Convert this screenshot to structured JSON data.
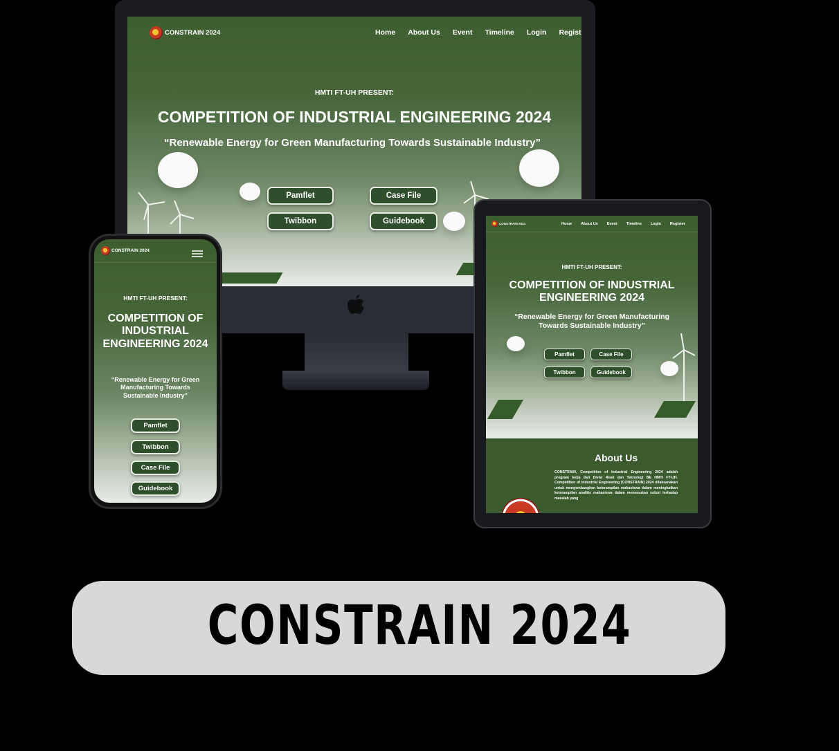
{
  "site": {
    "brand": "CONSTRAIN 2024",
    "nav": [
      "Home",
      "About Us",
      "Event",
      "Timeline",
      "Login",
      "Register"
    ],
    "desktop_nav_visible": [
      "Home",
      "About Us",
      "Event",
      "Timeline",
      "Login",
      "Registe"
    ],
    "presenter": "HMTI FT-UH PRESENT:",
    "title": "COMPETITION OF INDUSTRIAL ENGINEERING 2024",
    "tagline": "“Renewable Energy for Green Manufacturing Towards Sustainable Industry”",
    "buttons": {
      "pamflet": "Pamflet",
      "case_file": "Case File",
      "twibbon": "Twibbon",
      "guidebook": "Guidebook"
    },
    "about": {
      "heading": "About Us",
      "body": "CONSTRAIN, Competition of Industrial Engineering 2024 adalah program kerja dari Divisi Riset dan Teknologi BE HMTI FT-UH. Competition of Industrial Engineering (CONSTRAIN) 2024 dilaksanakan untuk mengembangkan keterampilan mahasiswa dalam meningkatkan keterampilan analitis mahasiswa dalam menemukan solusi terhadap masalah yang"
    },
    "colors": {
      "hero_green": "#3d5e2f",
      "button_green": "#2f4f2c",
      "logo_red": "#c83a24",
      "logo_gold": "#f2c230"
    }
  },
  "caption": "CONSTRAIN 2024"
}
